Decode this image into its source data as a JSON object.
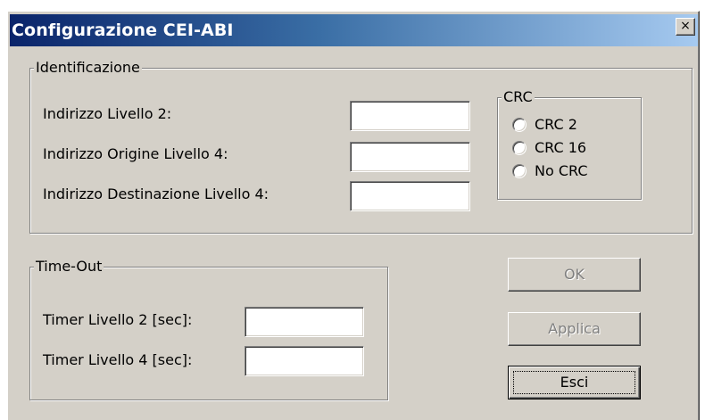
{
  "window": {
    "title": "Configurazione CEI-ABI",
    "close_glyph": "×"
  },
  "identificazione": {
    "legend": "Identificazione",
    "fields": [
      {
        "label": "Indirizzo Livello 2:",
        "value": ""
      },
      {
        "label": "Indirizzo Origine Livello 4:",
        "value": ""
      },
      {
        "label": "Indirizzo Destinazione Livello 4:",
        "value": ""
      }
    ]
  },
  "crc": {
    "legend": "CRC",
    "options": [
      {
        "label": "CRC 2",
        "selected": false
      },
      {
        "label": "CRC 16",
        "selected": false
      },
      {
        "label": "No CRC",
        "selected": false
      }
    ]
  },
  "timeout": {
    "legend": "Time-Out",
    "fields": [
      {
        "label": "Timer Livello 2 [sec]:",
        "value": ""
      },
      {
        "label": "Timer Livello 4 [sec]:",
        "value": ""
      }
    ]
  },
  "buttons": {
    "ok": "OK",
    "applica": "Applica",
    "esci": "Esci"
  },
  "colors": {
    "face": "#d4d0c8",
    "title_start": "#0a246a",
    "title_end": "#a6caf0",
    "disabled_text": "#808080"
  }
}
